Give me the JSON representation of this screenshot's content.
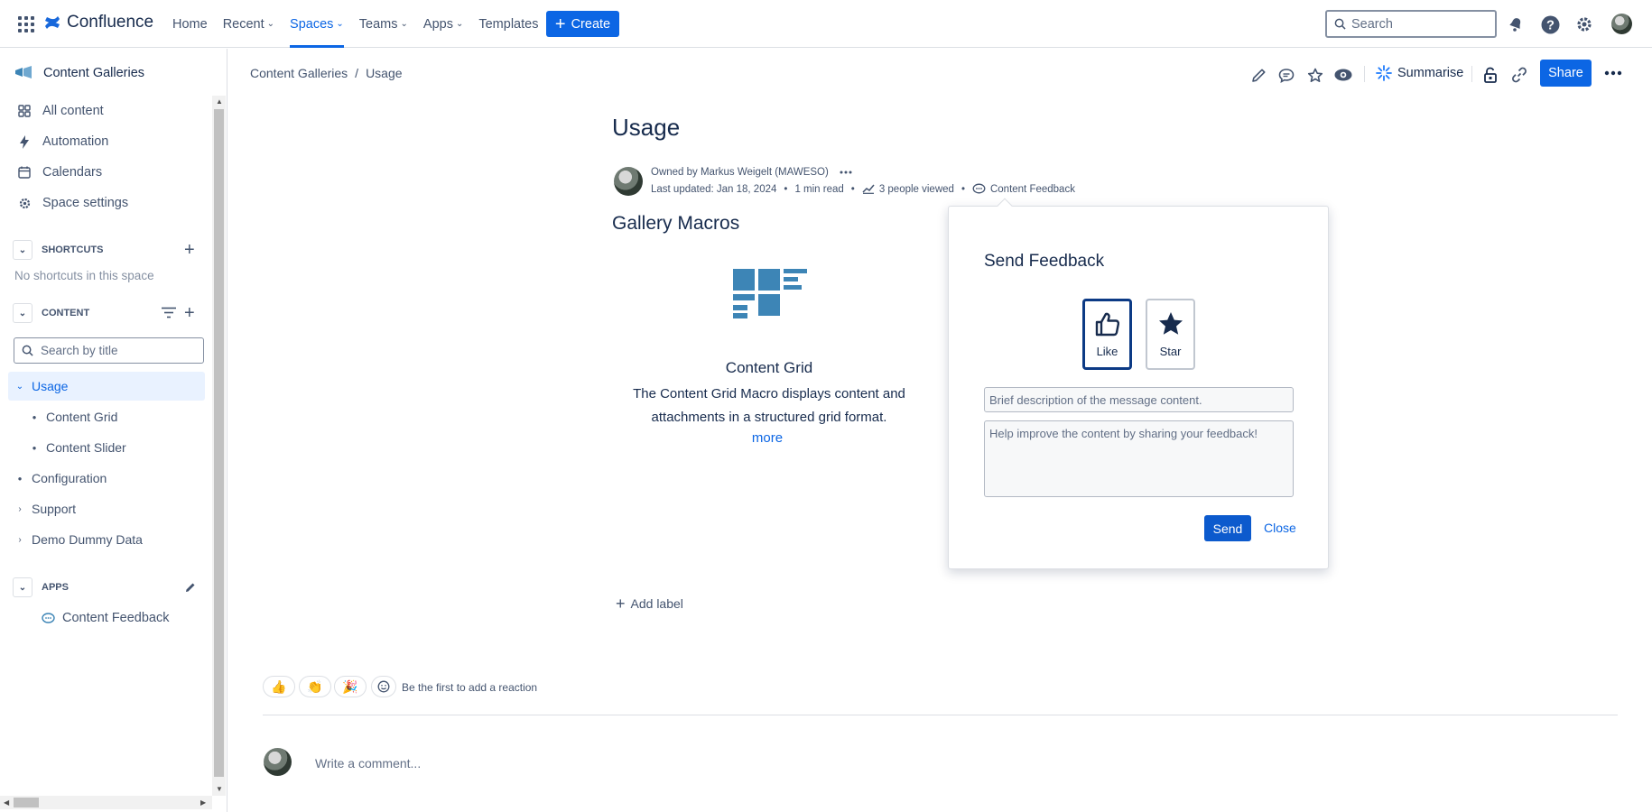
{
  "topnav": {
    "product": "Confluence",
    "items": [
      {
        "label": "Home",
        "chevron": false
      },
      {
        "label": "Recent",
        "chevron": true
      },
      {
        "label": "Spaces",
        "chevron": true
      },
      {
        "label": "Teams",
        "chevron": true
      },
      {
        "label": "Apps",
        "chevron": true
      },
      {
        "label": "Templates",
        "chevron": false
      }
    ],
    "create_label": "Create",
    "search_placeholder": "Search"
  },
  "sidebar": {
    "space_name": "Content Galleries",
    "items": [
      {
        "label": "All content",
        "icon": "all-content-icon"
      },
      {
        "label": "Automation",
        "icon": "lightning-icon"
      },
      {
        "label": "Calendars",
        "icon": "calendar-icon"
      },
      {
        "label": "Space settings",
        "icon": "gear-icon"
      }
    ],
    "shortcuts_header": "SHORTCUTS",
    "shortcuts_empty": "No shortcuts in this space",
    "content_header": "CONTENT",
    "search_placeholder": "Search by title",
    "tree": [
      {
        "label": "Usage"
      },
      {
        "label": "Content Grid"
      },
      {
        "label": "Content Slider"
      },
      {
        "label": "Configuration"
      },
      {
        "label": "Support"
      },
      {
        "label": "Demo Dummy Data"
      }
    ],
    "apps_header": "APPS",
    "apps": [
      {
        "label": "Content Feedback"
      }
    ]
  },
  "breadcrumb": {
    "space": "Content Galleries",
    "sep": "/",
    "page": "Usage"
  },
  "toolbar": {
    "summarise_label": "Summarise",
    "share_label": "Share"
  },
  "page": {
    "title": "Usage",
    "owned_by": "Owned by Markus Weigelt (MAWESO)",
    "last_updated": "Last updated: Jan 18, 2024",
    "read_time": "1 min read",
    "viewed": "3 people viewed",
    "feedback_link": "Content Feedback",
    "section_heading": "Gallery Macros",
    "macro": {
      "title": "Content Grid",
      "description": "The Content Grid Macro displays content and attachments in a structured grid format.",
      "more": "more"
    },
    "add_label": "Add label"
  },
  "feedback_dialog": {
    "title": "Send Feedback",
    "like_label": "Like",
    "star_label": "Star",
    "subject_placeholder": "Brief description of the message content.",
    "message_placeholder": "Help improve the content by sharing your feedback!",
    "send_label": "Send",
    "close_label": "Close"
  },
  "reactions": {
    "emojis": [
      "👍",
      "👏",
      "🎉"
    ],
    "prompt": "Be the first to add a reaction"
  },
  "comments": {
    "placeholder": "Write a comment..."
  },
  "colors": {
    "accent": "#0C66E4",
    "text": "#172B4D",
    "subtle": "#44546F",
    "selected_bg": "#E9F2FF",
    "macro_icon": "#3D85B6"
  }
}
